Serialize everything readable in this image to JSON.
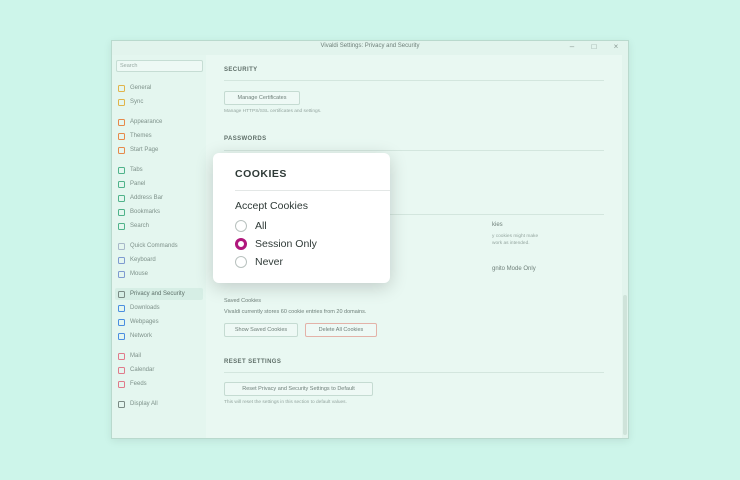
{
  "window": {
    "title": "Vivaldi Settings: Privacy and Security"
  },
  "search": {
    "placeholder": "Search"
  },
  "sidebar": {
    "items": [
      {
        "label": "General",
        "icon": "general-icon",
        "color": "#e0b44a"
      },
      {
        "label": "Sync",
        "icon": "sync-icon",
        "color": "#e0b44a"
      },
      {
        "label": "Appearance",
        "icon": "appearance-icon",
        "color": "#e6894a"
      },
      {
        "label": "Themes",
        "icon": "themes-icon",
        "color": "#e6894a"
      },
      {
        "label": "Start Page",
        "icon": "start-page-icon",
        "color": "#e6894a"
      },
      {
        "label": "Tabs",
        "icon": "tabs-icon",
        "color": "#4fb38a"
      },
      {
        "label": "Panel",
        "icon": "panel-icon",
        "color": "#4fb38a"
      },
      {
        "label": "Address Bar",
        "icon": "address-bar-icon",
        "color": "#4fb38a"
      },
      {
        "label": "Bookmarks",
        "icon": "bookmarks-icon",
        "color": "#4fb38a"
      },
      {
        "label": "Search",
        "icon": "search-icon",
        "color": "#4fb38a"
      },
      {
        "label": "Quick Commands",
        "icon": "quick-commands-icon",
        "color": "#a8b8c8"
      },
      {
        "label": "Keyboard",
        "icon": "keyboard-icon",
        "color": "#7e9ad0"
      },
      {
        "label": "Mouse",
        "icon": "mouse-icon",
        "color": "#7e9ad0"
      },
      {
        "label": "Privacy and Security",
        "icon": "shield-icon",
        "color": "#7a8a84"
      },
      {
        "label": "Downloads",
        "icon": "downloads-icon",
        "color": "#4a8ee0"
      },
      {
        "label": "Webpages",
        "icon": "webpages-icon",
        "color": "#4a8ee0"
      },
      {
        "label": "Network",
        "icon": "network-icon",
        "color": "#4a8ee0"
      },
      {
        "label": "Mail",
        "icon": "mail-icon",
        "color": "#e07a8a"
      },
      {
        "label": "Calendar",
        "icon": "calendar-icon",
        "color": "#e07a8a"
      },
      {
        "label": "Feeds",
        "icon": "feeds-icon",
        "color": "#e07a8a"
      },
      {
        "label": "Display All",
        "icon": "gear-icon",
        "color": "#7a8a84"
      }
    ]
  },
  "security": {
    "heading": "SECURITY",
    "manage_button": "Manage Certificates",
    "manage_hint": "Manage HTTPS/SSL certificates and settings."
  },
  "passwords": {
    "heading": "PASSWORDS"
  },
  "cookies_partial": {
    "line1": "kies",
    "line2": "y cookies might make",
    "line3": "work as intended.",
    "line4": "gnito Mode Only"
  },
  "saved_cookies": {
    "title": "Saved Cookies",
    "text": "Vivaldi currently stores 60 cookie entries from 20 domains.",
    "show_button": "Show Saved Cookies",
    "delete_button": "Delete All Cookies"
  },
  "reset": {
    "heading": "RESET SETTINGS",
    "button": "Reset Privacy and Security Settings to Default",
    "hint": "This will reset the settings in this section to default values."
  },
  "popup": {
    "title": "COOKIES",
    "label": "Accept Cookies",
    "options": [
      {
        "label": "All",
        "checked": false
      },
      {
        "label": "Session Only",
        "checked": true
      },
      {
        "label": "Never",
        "checked": false
      }
    ],
    "accent": "#b0177c"
  }
}
